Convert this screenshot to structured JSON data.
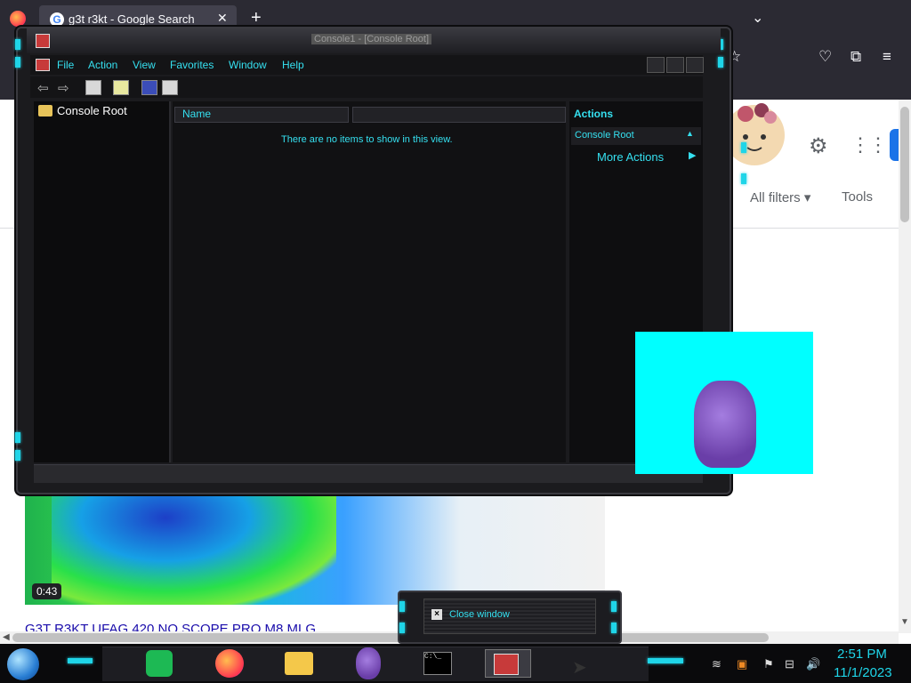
{
  "browser": {
    "tab_title": "g3t r3kt - Google Search",
    "tab_close": "✕",
    "new_tab": "+",
    "tab_list": "⌄",
    "toolbar_icons": [
      "star-icon",
      "pocket-icon",
      "extensions-icon",
      "menu-icon"
    ]
  },
  "google": {
    "all_filters": "All filters ▾",
    "tools": "Tools",
    "video_duration": "0:43",
    "video_title": "G3T R3KT UFAG 420 NO SCOPE PRO M8 MLG"
  },
  "mmc": {
    "title": "Console1 - [Console Root]",
    "menu": [
      "File",
      "Action",
      "View",
      "Favorites",
      "Window",
      "Help"
    ],
    "tree_root": "Console Root",
    "column_name": "Name",
    "empty_message": "There are no items to show in this view.",
    "actions_header": "Actions",
    "actions_section": "Console Root",
    "more_actions": "More Actions"
  },
  "close_widget": {
    "label": "Close window",
    "x": "×"
  },
  "taskbar": {
    "cmd_text": "C:\\_",
    "clock_time": "2:51 PM",
    "clock_date": "11/1/2023"
  },
  "colors": {
    "accent_cyan": "#35e0f0",
    "mmc_bg": "#1b1b1e",
    "bonzi_bg": "#00ffff"
  }
}
